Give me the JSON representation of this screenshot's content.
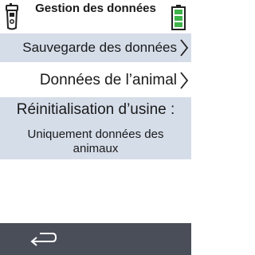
{
  "header": {
    "title": "Gestion des données",
    "left_icon": "device-icon",
    "right_icon": "battery-icon"
  },
  "menu": {
    "backup_label": "Sauvegarde des données",
    "animal_label": "Données de l’animal",
    "reset_title": "Réinitialisation d’usine :",
    "reset_subtitle": "Uniquement données des animaux",
    "chevron_icon": "chevron-right-icon"
  },
  "footer": {
    "back_icon": "back-arrow-icon"
  },
  "colors": {
    "highlight_row": "#d5dde9",
    "footer_bar": "#4a4e58",
    "battery_green": "#3fb44a"
  }
}
